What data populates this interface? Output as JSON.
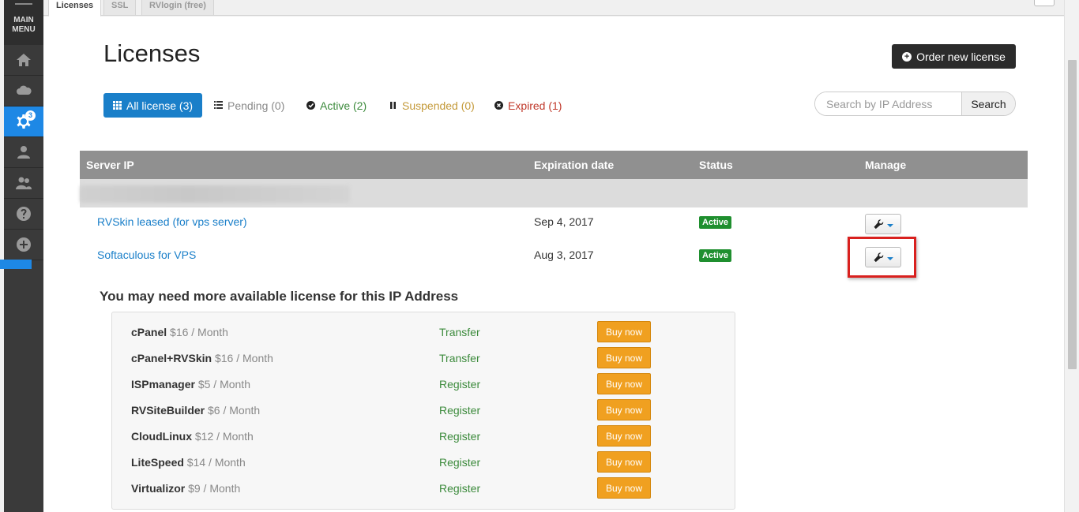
{
  "sidebar": {
    "menu_line1": "MAIN",
    "menu_line2": "MENU",
    "items": [
      {
        "icon": "home-icon"
      },
      {
        "icon": "cloud-icon"
      },
      {
        "icon": "gear-icon",
        "badge": "3",
        "active": true
      },
      {
        "icon": "user-icon"
      },
      {
        "icon": "users-icon"
      },
      {
        "icon": "help-icon"
      },
      {
        "icon": "add-icon"
      }
    ]
  },
  "tabs": [
    {
      "label": "Licenses",
      "active": true
    },
    {
      "label": "SSL"
    },
    {
      "label": "RVlogin (free)"
    }
  ],
  "page": {
    "title": "Licenses",
    "order_button": "Order new license"
  },
  "filters": {
    "all": "All license (3)",
    "pending": "Pending (0)",
    "active": "Active (2)",
    "suspended": "Suspended (0)",
    "expired": "Expired (1)"
  },
  "search": {
    "placeholder": "Search by IP Address",
    "button": "Search"
  },
  "table": {
    "headers": [
      "Server IP",
      "Expiration date",
      "Status",
      "Manage"
    ],
    "rows": [
      {
        "name": "RVSkin leased (for vps server)",
        "date": "Sep 4, 2017",
        "status": "Active"
      },
      {
        "name": "Softaculous for VPS",
        "date": "Aug 3, 2017",
        "status": "Active"
      }
    ]
  },
  "more": {
    "title": "You may need more available license for this IP Address",
    "buy_label": "Buy now",
    "offers": [
      {
        "name": "cPanel",
        "price": "$16 / Month",
        "action": "Transfer"
      },
      {
        "name": "cPanel+RVSkin",
        "price": "$16 / Month",
        "action": "Transfer"
      },
      {
        "name": "ISPmanager",
        "price": "$5 / Month",
        "action": "Register"
      },
      {
        "name": "RVSiteBuilder",
        "price": "$6 / Month",
        "action": "Register"
      },
      {
        "name": "CloudLinux",
        "price": "$12 / Month",
        "action": "Register"
      },
      {
        "name": "LiteSpeed",
        "price": "$14 / Month",
        "action": "Register"
      },
      {
        "name": "Virtualizor",
        "price": "$9 / Month",
        "action": "Register"
      }
    ]
  },
  "colors": {
    "accent": "#1a7fc9",
    "active_badge": "#1f8f2f",
    "buy_button": "#f0a020",
    "highlight": "#d9201e"
  }
}
